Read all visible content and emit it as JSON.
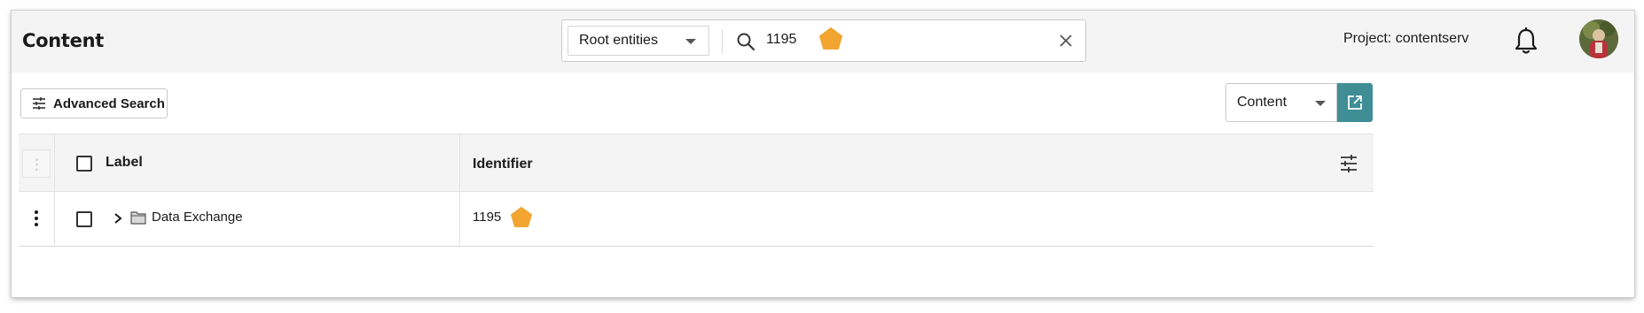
{
  "header": {
    "title": "Content",
    "scope_select": "Root entities",
    "search_value": "1195",
    "project_label": "Project: contentserv"
  },
  "toolbar": {
    "advanced_search_label": "Advanced Search",
    "view_select": "Content"
  },
  "table": {
    "columns": [
      "Label",
      "Identifier"
    ],
    "rows": [
      {
        "label": "Data Exchange",
        "identifier": "1195"
      }
    ]
  },
  "colors": {
    "accent": "#3f8e96",
    "badge": "#f2a530",
    "header_bg": "#f4f4f4"
  },
  "icons": [
    "search-icon",
    "clear-icon",
    "bell-icon",
    "filter-sliders-icon",
    "open-external-icon",
    "kebab-menu-icon",
    "chevron-right-icon",
    "folder-icon",
    "pentagon-badge-icon"
  ]
}
